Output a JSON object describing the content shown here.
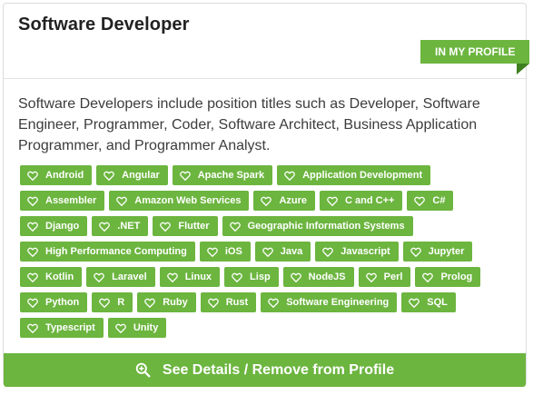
{
  "card": {
    "title": "Software Developer",
    "badge": "IN MY PROFILE",
    "description": "Software Developers include position titles such as Developer, Software Engineer, Programmer, Coder, Software Architect, Business Application Programmer, and Programmer Analyst.",
    "tag_icon": "heart-outline-icon",
    "tags": [
      "Android",
      "Angular",
      "Apache Spark",
      "Application Development",
      "Assembler",
      "Amazon Web Services",
      "Azure",
      "C and C++",
      "C#",
      "Django",
      ".NET",
      "Flutter",
      "Geographic Information Systems",
      "High Performance Computing",
      "iOS",
      "Java",
      "Javascript",
      "Jupyter",
      "Kotlin",
      "Laravel",
      "Linux",
      "Lisp",
      "NodeJS",
      "Perl",
      "Prolog",
      "Python",
      "R",
      "Ruby",
      "Rust",
      "Software Engineering",
      "SQL",
      "Typescript",
      "Unity"
    ],
    "action_label": "See Details / Remove from Profile",
    "action_icon": "zoom-in-icon"
  },
  "colors": {
    "accent": "#6cb53f",
    "ribbon_fold": "#3f7f1f",
    "title_text": "#222222",
    "body_text": "#3c3c3c"
  }
}
